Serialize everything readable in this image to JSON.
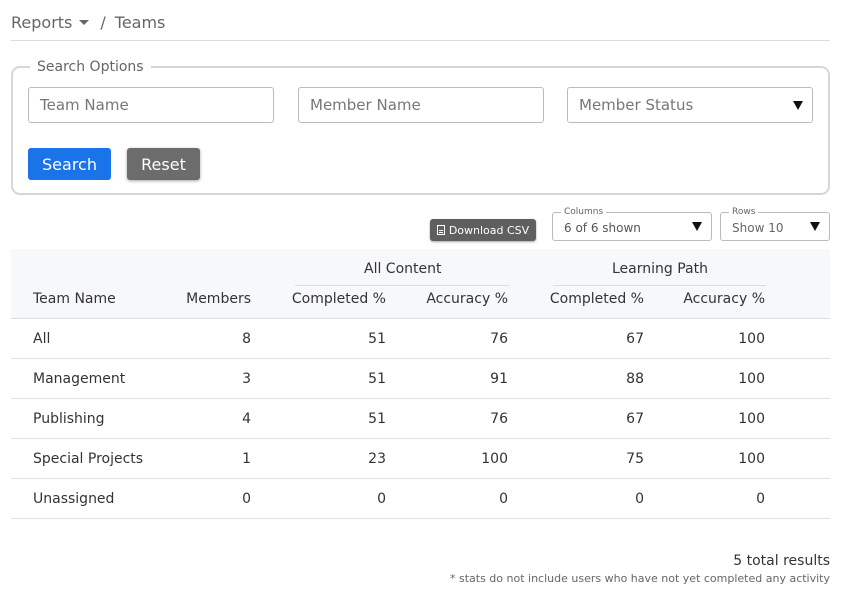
{
  "breadcrumb": {
    "parent": "Reports",
    "separator": "/",
    "current": "Teams"
  },
  "search": {
    "legend": "Search Options",
    "team_placeholder": "Team Name",
    "member_placeholder": "Member Name",
    "status_placeholder": "Member Status",
    "search_label": "Search",
    "reset_label": "Reset"
  },
  "toolbar": {
    "csv_label": "Download CSV",
    "columns": {
      "legend": "Columns",
      "value": "6 of 6 shown"
    },
    "rows": {
      "legend": "Rows",
      "value": "Show 10"
    }
  },
  "table": {
    "groups": {
      "all_content": "All Content",
      "learning_path": "Learning Path"
    },
    "headers": {
      "team_name": "Team Name",
      "members": "Members",
      "ac_completed": "Completed %",
      "ac_accuracy": "Accuracy %",
      "lp_completed": "Completed %",
      "lp_accuracy": "Accuracy %"
    },
    "rows": [
      {
        "name": "All",
        "members": "8",
        "ac_completed": "51",
        "ac_accuracy": "76",
        "lp_completed": "67",
        "lp_accuracy": "100"
      },
      {
        "name": "Management",
        "members": "3",
        "ac_completed": "51",
        "ac_accuracy": "91",
        "lp_completed": "88",
        "lp_accuracy": "100"
      },
      {
        "name": "Publishing",
        "members": "4",
        "ac_completed": "51",
        "ac_accuracy": "76",
        "lp_completed": "67",
        "lp_accuracy": "100"
      },
      {
        "name": "Special Projects",
        "members": "1",
        "ac_completed": "23",
        "ac_accuracy": "100",
        "lp_completed": "75",
        "lp_accuracy": "100"
      },
      {
        "name": "Unassigned",
        "members": "0",
        "ac_completed": "0",
        "ac_accuracy": "0",
        "lp_completed": "0",
        "lp_accuracy": "0"
      }
    ]
  },
  "footer": {
    "total": "5 total results",
    "note": "* stats do not include users who have not yet completed any activity"
  },
  "colors": {
    "primary": "#1a73e8",
    "secondary": "#6c6c6c"
  }
}
